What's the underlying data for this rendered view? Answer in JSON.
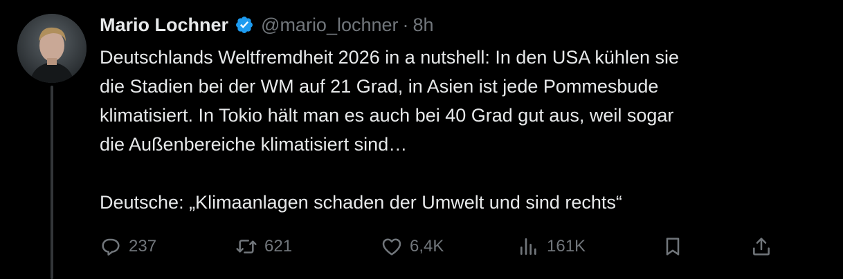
{
  "author": {
    "display_name": "Mario Lochner",
    "handle": "@mario_lochner",
    "separator": "·",
    "time": "8h",
    "verified_color": "#1d9bf0"
  },
  "tweet": {
    "lines": [
      "Deutschlands Weltfremdheit 2026 in a nutshell: In den USA kühlen sie",
      "die Stadien bei der WM auf 21 Grad, in Asien ist jede Pommesbude",
      "klimatisiert. In Tokio hält man es auch bei 40 Grad gut aus, weil sogar",
      "die Außenbereiche klimatisiert sind…",
      "Deutsche: „Klimaanlagen schaden der Umwelt und sind rechts“"
    ]
  },
  "actions": {
    "replies": "237",
    "reposts": "621",
    "likes": "6,4K",
    "views": "161K"
  },
  "colors": {
    "background": "#000000",
    "text": "#e7e9ea",
    "muted": "#71767b",
    "thread_line": "#333639"
  },
  "icons": {
    "reply": "reply-icon",
    "repost": "repost-icon",
    "like": "heart-icon",
    "views": "views-icon",
    "bookmark": "bookmark-icon",
    "share": "share-icon",
    "verified": "verified-badge-icon"
  }
}
